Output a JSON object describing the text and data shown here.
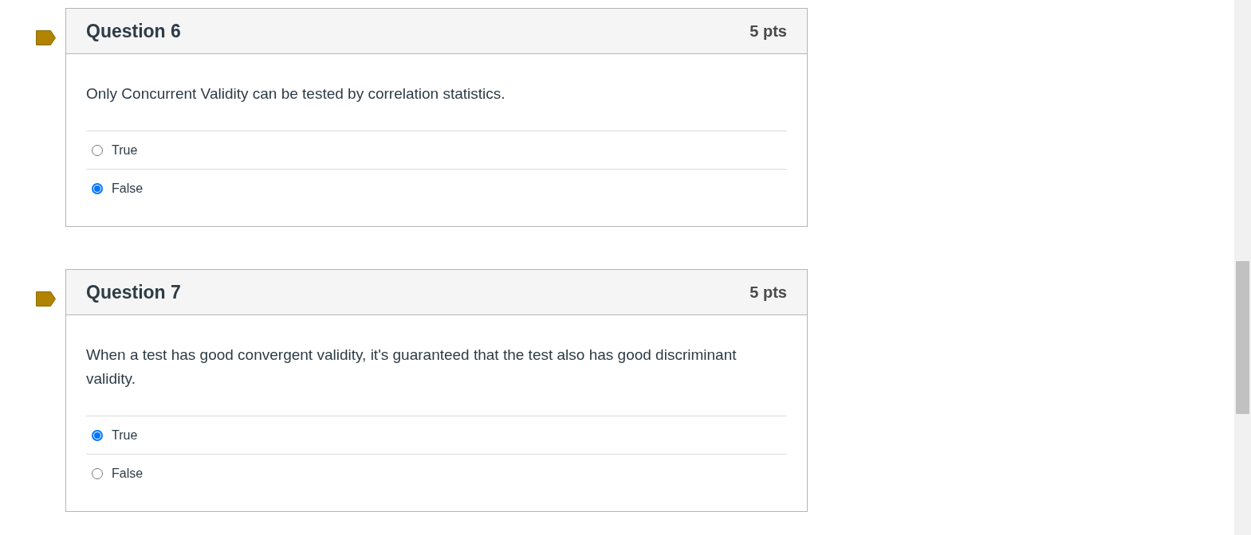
{
  "questions": [
    {
      "title": "Question 6",
      "points": "5 pts",
      "text": "Only Concurrent Validity can be tested by correlation statistics.",
      "answers": [
        {
          "label": "True",
          "selected": false
        },
        {
          "label": "False",
          "selected": true
        }
      ]
    },
    {
      "title": "Question 7",
      "points": "5 pts",
      "text": "When a test has good convergent validity, it's guaranteed that the test also has good discriminant validity.",
      "answers": [
        {
          "label": "True",
          "selected": true
        },
        {
          "label": "False",
          "selected": false
        }
      ]
    }
  ]
}
